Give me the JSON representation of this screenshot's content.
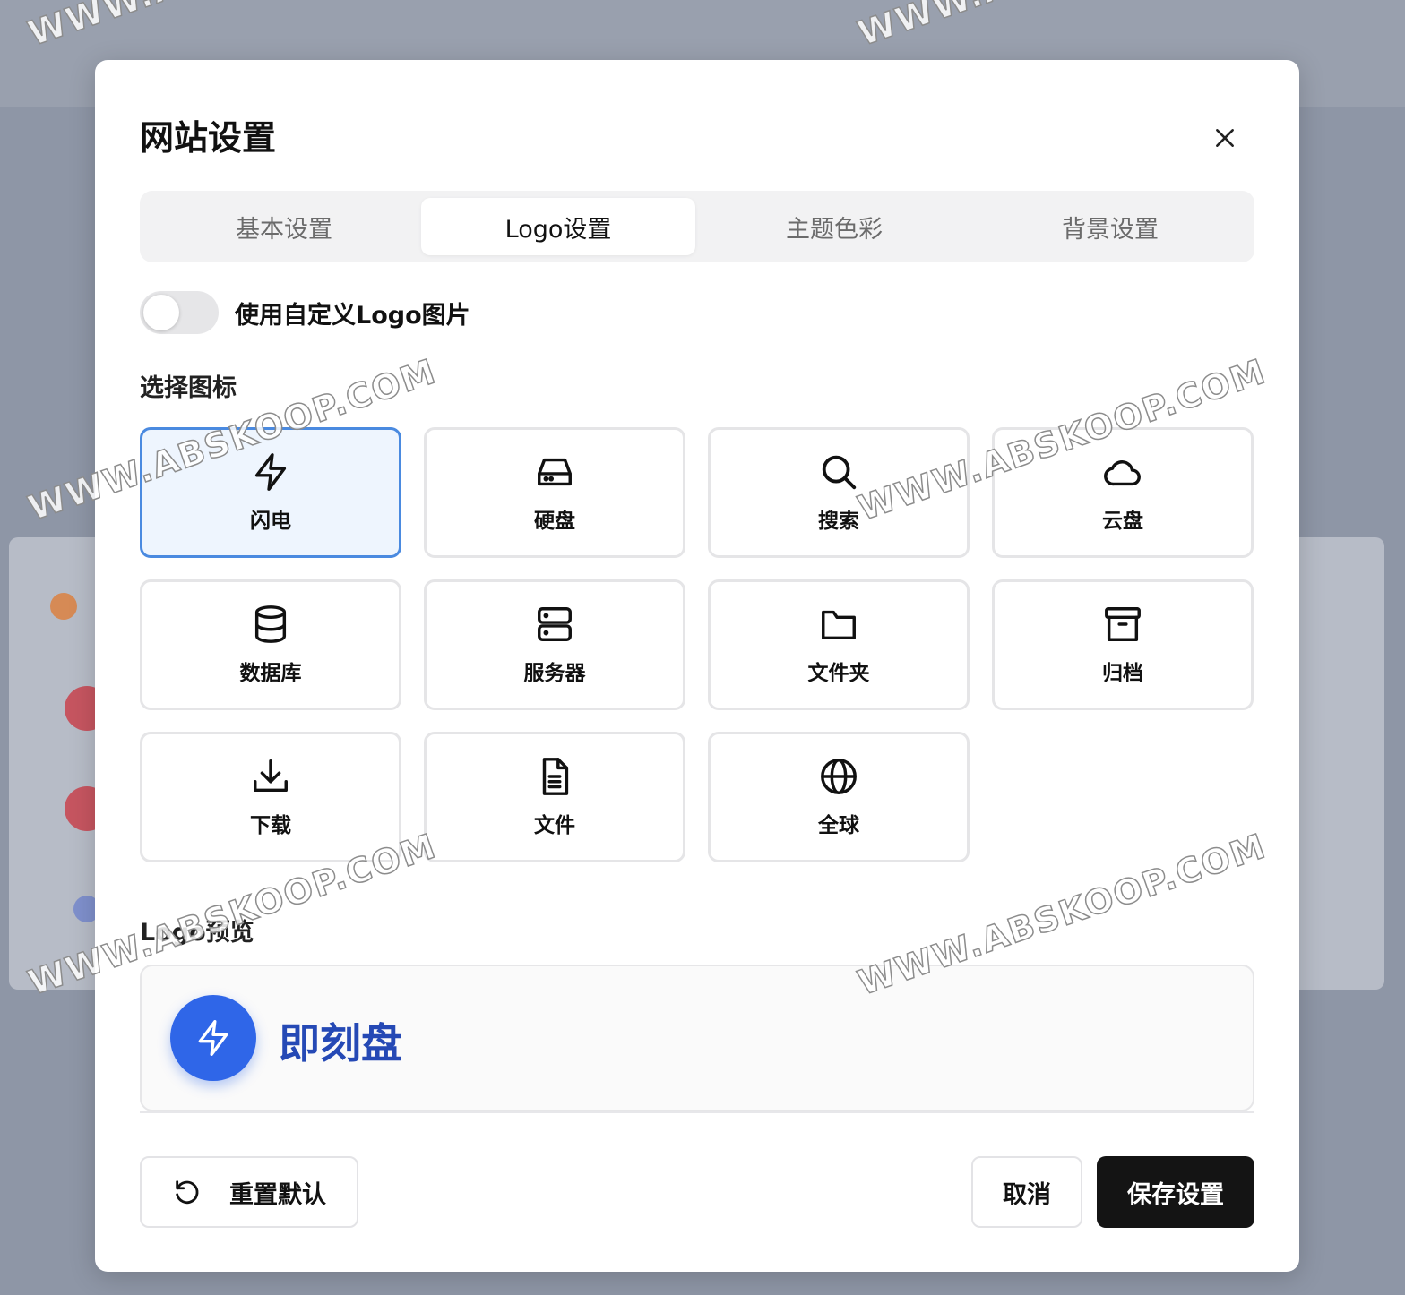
{
  "dialog": {
    "title": "网站设置",
    "close_icon": "close-icon"
  },
  "tabs": [
    {
      "label": "基本设置",
      "active": false
    },
    {
      "label": "Logo设置",
      "active": true
    },
    {
      "label": "主题色彩",
      "active": false
    },
    {
      "label": "背景设置",
      "active": false
    }
  ],
  "custom_logo_toggle": {
    "label": "使用自定义Logo图片",
    "enabled": false
  },
  "icon_section": {
    "label": "选择图标",
    "options": [
      {
        "label": "闪电",
        "icon": "lightning-icon",
        "selected": true
      },
      {
        "label": "硬盘",
        "icon": "hard-drive-icon",
        "selected": false
      },
      {
        "label": "搜索",
        "icon": "search-icon",
        "selected": false
      },
      {
        "label": "云盘",
        "icon": "cloud-icon",
        "selected": false
      },
      {
        "label": "数据库",
        "icon": "database-icon",
        "selected": false
      },
      {
        "label": "服务器",
        "icon": "server-icon",
        "selected": false
      },
      {
        "label": "文件夹",
        "icon": "folder-icon",
        "selected": false
      },
      {
        "label": "归档",
        "icon": "archive-icon",
        "selected": false
      },
      {
        "label": "下载",
        "icon": "download-icon",
        "selected": false
      },
      {
        "label": "文件",
        "icon": "file-icon",
        "selected": false
      },
      {
        "label": "全球",
        "icon": "globe-icon",
        "selected": false
      }
    ]
  },
  "preview": {
    "label": "Logo预览",
    "site_name": "即刻盘",
    "icon": "lightning-icon",
    "badge_color": "#2f66e8",
    "name_color": "#2549b5"
  },
  "footer": {
    "reset_label": "重置默认",
    "reset_icon": "reset-icon",
    "cancel_label": "取消",
    "save_label": "保存设置"
  },
  "watermark": "WWW.ABSKOOP.COM"
}
